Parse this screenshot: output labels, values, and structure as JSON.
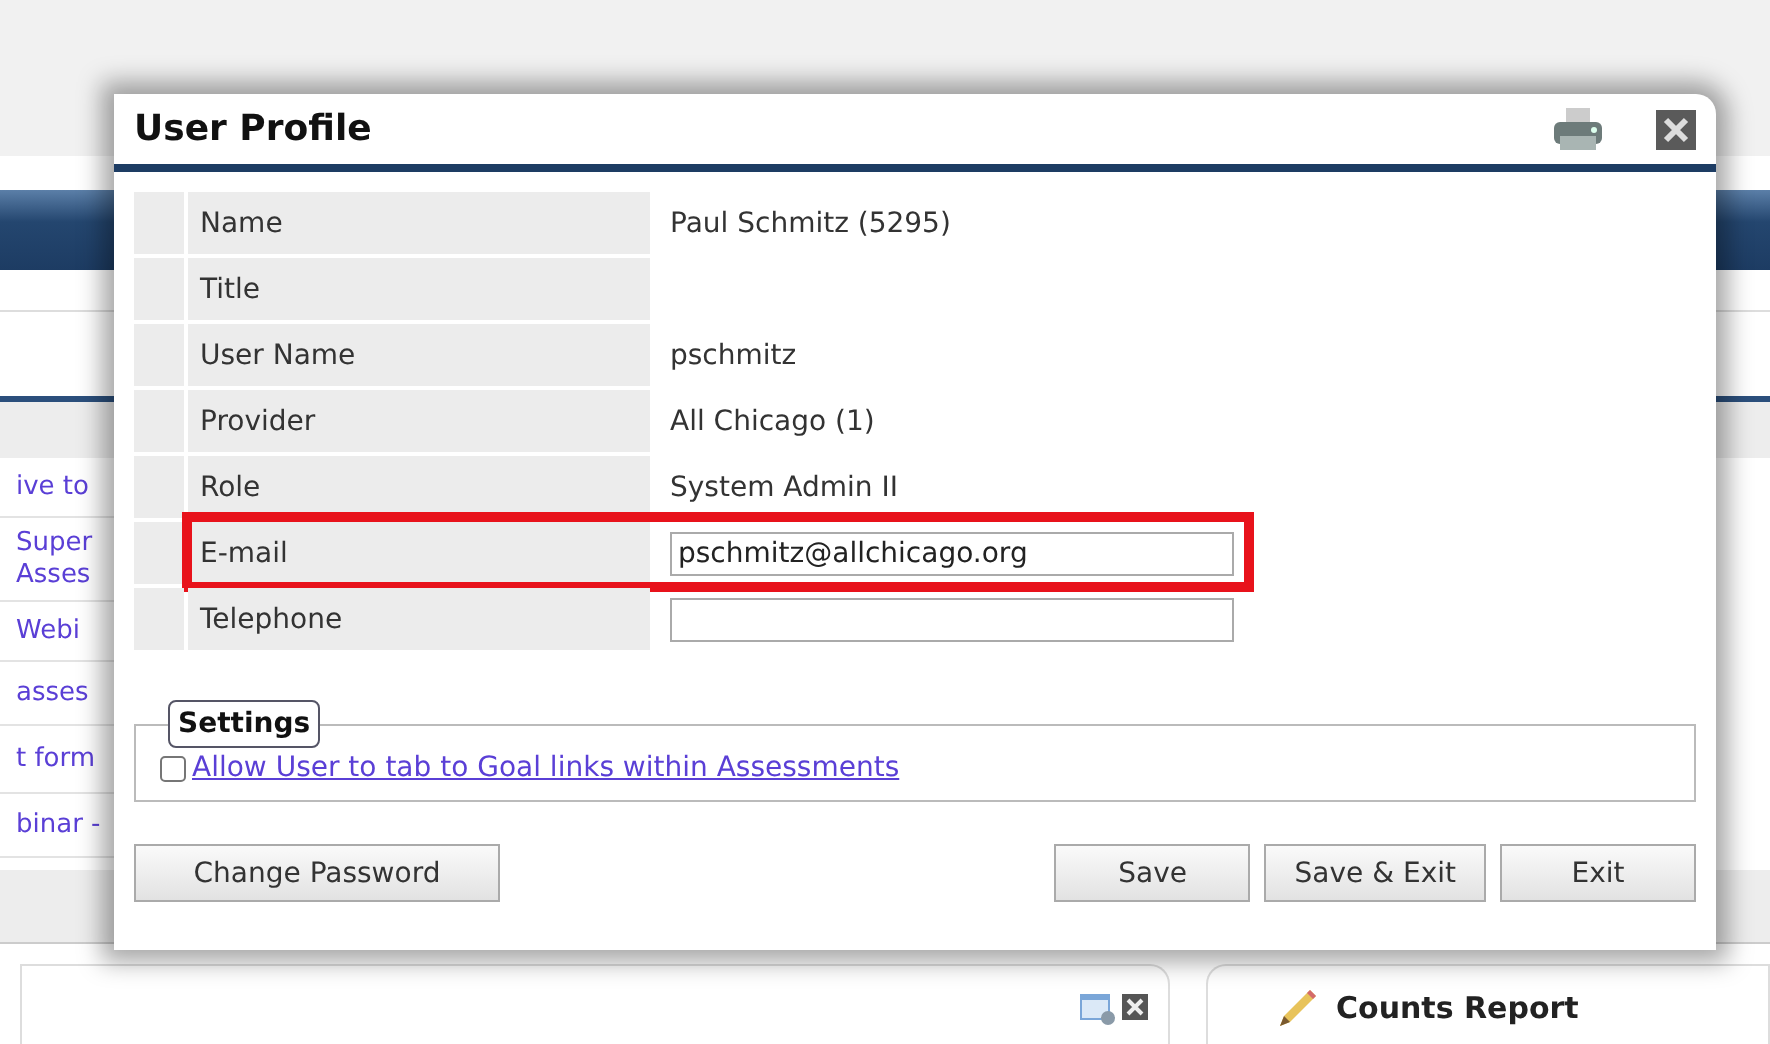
{
  "background": {
    "link_rows": [
      {
        "lines": [
          "ive to"
        ]
      },
      {
        "lines": [
          "Super",
          "Asses"
        ]
      },
      {
        "lines": [
          "Webi"
        ]
      },
      {
        "lines": [
          "asses"
        ]
      },
      {
        "lines": [
          "t form"
        ]
      },
      {
        "lines": [
          "binar -"
        ]
      }
    ],
    "tab": {
      "label": "Counts Report"
    }
  },
  "dialog": {
    "title": "User Profile",
    "fields": [
      {
        "label": "Name",
        "kind": "text",
        "value": "Paul Schmitz (5295)",
        "highlighted": false
      },
      {
        "label": "Title",
        "kind": "text",
        "highlighted": false
      },
      {
        "label": "User Name",
        "kind": "text",
        "value": "pschmitz",
        "highlighted": false
      },
      {
        "label": "Provider",
        "kind": "text",
        "value": "All Chicago (1)",
        "highlighted": false
      },
      {
        "label": "Role",
        "kind": "text",
        "value": "System Admin II",
        "highlighted": false
      },
      {
        "label": "E-mail",
        "kind": "input",
        "value": "pschmitz@allchicago.org",
        "highlighted": true
      },
      {
        "label": "Telephone",
        "kind": "input",
        "highlighted": false
      }
    ],
    "settings": {
      "legend": "Settings",
      "options": [
        {
          "label": "Allow User to tab to Goal links within Assessments",
          "checked": false
        }
      ]
    },
    "buttons": [
      {
        "label": "Change Password",
        "kind": "left"
      },
      {
        "label": "Save",
        "kind": "right"
      },
      {
        "label": "Save & Exit",
        "kind": "right"
      },
      {
        "label": "Exit",
        "kind": "right"
      }
    ]
  }
}
